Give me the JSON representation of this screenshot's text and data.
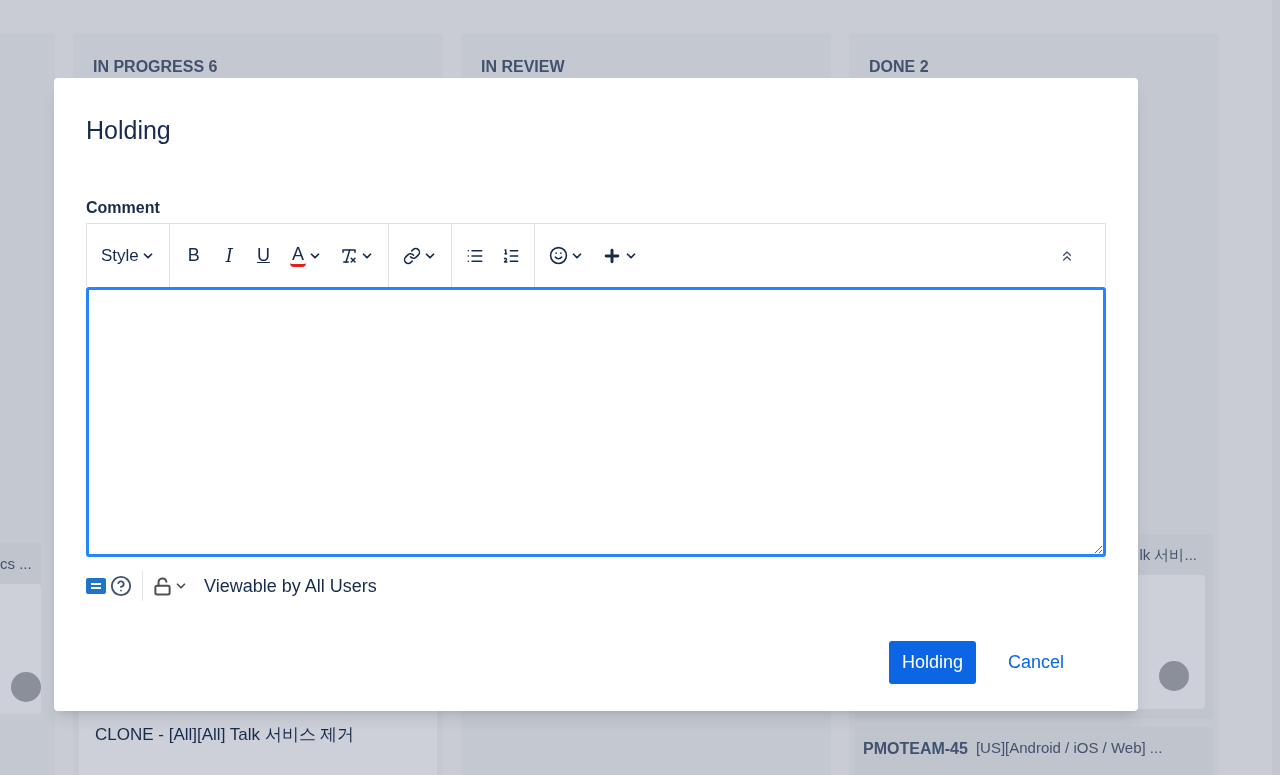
{
  "board": {
    "left_column": {
      "group_title": "cs ..."
    },
    "columns": [
      {
        "title": "IN PROGRESS 6",
        "cards": [
          {
            "text": "CLONE - [All][All] Talk 서비스 제거"
          }
        ]
      },
      {
        "title": "IN REVIEW"
      },
      {
        "title": "DONE 2",
        "group_title": "lk 서비...",
        "next_group": {
          "key": "PMOTEAM-45",
          "text": "[US][Android / iOS / Web] ..."
        }
      }
    ]
  },
  "dialog": {
    "title": "Holding",
    "field_label": "Comment",
    "toolbar": [
      [
        {
          "kind": "menu",
          "label": "Style",
          "dropdown": true
        }
      ],
      [
        {
          "kind": "bold",
          "label": "B",
          "dropdown": false
        },
        {
          "kind": "italic",
          "label": "I",
          "dropdown": false
        },
        {
          "kind": "underline",
          "label": "U",
          "dropdown": false
        },
        {
          "kind": "color",
          "label": "A",
          "dropdown": true
        },
        {
          "kind": "clear",
          "dropdown": true
        }
      ],
      [
        {
          "kind": "link",
          "dropdown": true
        }
      ],
      [
        {
          "kind": "bullets",
          "dropdown": false
        },
        {
          "kind": "numbers",
          "dropdown": false
        }
      ],
      [
        {
          "kind": "emoji",
          "dropdown": true
        },
        {
          "kind": "insert",
          "dropdown": true
        }
      ]
    ],
    "visibility": "Viewable by All Users",
    "buttons": [
      {
        "kind": "primary",
        "label": "Holding"
      },
      {
        "kind": "link",
        "label": "Cancel"
      }
    ]
  }
}
